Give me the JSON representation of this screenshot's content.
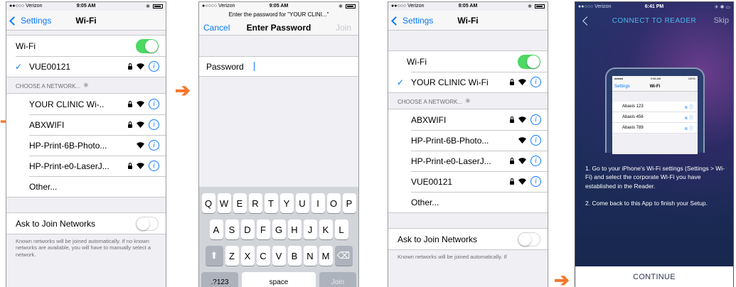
{
  "screen1": {
    "status": {
      "carrier": "●●○○○ Verizon",
      "time": "9:05 AM"
    },
    "nav": {
      "back": "Settings",
      "title": "Wi-Fi"
    },
    "wifi_label": "Wi-Fi",
    "connected": "VUE00121",
    "section": "CHOOSE A NETWORK...",
    "networks": [
      "YOUR CLINIC Wi-..",
      "ABXWIFI",
      "HP-Print-6B-Photo...",
      "HP-Print-e0-LaserJ...",
      "Other..."
    ],
    "ask_label": "Ask to Join Networks",
    "footnote": "Known networks will be joined automatically. If no known networks are available, you will have to manually select a network."
  },
  "screen2": {
    "status": {
      "carrier": "●○○○○ Verizon",
      "time": "9:05 AM"
    },
    "prompt": "Enter the password for \"YOUR CLINI...\"",
    "nav": {
      "cancel": "Cancel",
      "title": "Enter Password",
      "join": "Join"
    },
    "field_label": "Password",
    "keys": {
      "row1": [
        "Q",
        "W",
        "E",
        "R",
        "T",
        "Y",
        "U",
        "I",
        "O",
        "P"
      ],
      "row2": [
        "A",
        "S",
        "D",
        "F",
        "G",
        "H",
        "J",
        "K",
        "L"
      ],
      "row3": [
        "Z",
        "X",
        "C",
        "V",
        "B",
        "N",
        "M"
      ],
      "numbers": ".?123",
      "space": "space",
      "join": "Join"
    }
  },
  "screen3": {
    "status": {
      "carrier": "●●○○○ Verizon",
      "time": "9:05 AM"
    },
    "nav": {
      "back": "Settings",
      "title": "Wi-Fi"
    },
    "wifi_label": "Wi-Fi",
    "connected": "YOUR CLINIC Wi-Fi",
    "section": "CHOOSE A NETWORK...",
    "networks": [
      "ABXWIFI",
      "HP-Print-6B-Photo...",
      "HP-Print-e0-LaserJ...",
      "VUE00121",
      "Other..."
    ],
    "ask_label": "Ask to Join Networks",
    "footnote": "Known networks will be joined automatically. If"
  },
  "screen4": {
    "status": {
      "carrier": "●●○○○ Verizon",
      "time": "6:41 PM"
    },
    "title": "CONNECT TO READER",
    "skip": "Skip",
    "mini": {
      "time": "9:08 AM",
      "battery": "100%",
      "back": "Settings",
      "title": "Wi-Fi",
      "networks": [
        "Abaxis 123",
        "Abaxis 456",
        "Abaxis 789"
      ]
    },
    "step1": "1. Go to your iPhone's Wi-Fi settings (Settings > Wi-Fi) and select the corporate Wi-Fi you have established in the Reader.",
    "step2": "2. Come back to this App to finish your Setup.",
    "continue": "CONTINUE"
  },
  "arrows": {
    "glyph": "➔",
    "color": "#f4762a"
  }
}
